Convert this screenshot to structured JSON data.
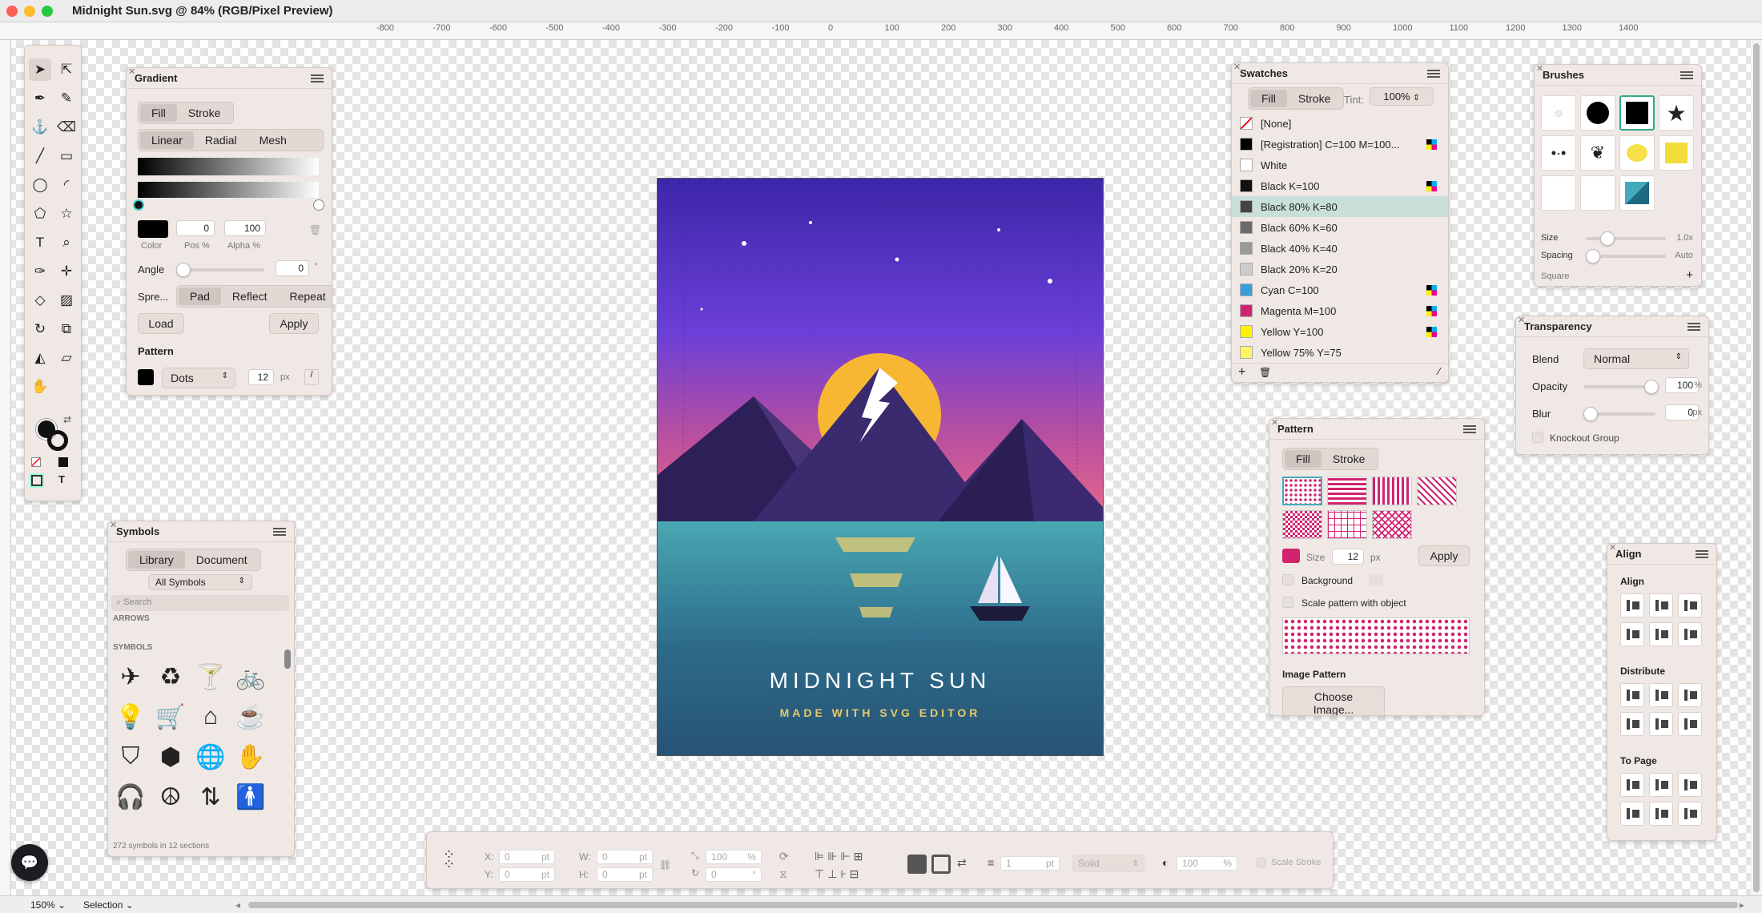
{
  "window": {
    "title": "Midnight Sun.svg @ 84% (RGB/Pixel Preview)"
  },
  "ruler": {
    "ticks": [
      "-800",
      "-700",
      "-600",
      "-500",
      "-400",
      "-300",
      "-200",
      "-100",
      "0",
      "100",
      "200",
      "300",
      "400",
      "500",
      "600",
      "700",
      "800",
      "900",
      "1000",
      "1100",
      "1200",
      "1300",
      "1400"
    ]
  },
  "status": {
    "zoom": "150%",
    "mode": "Selection"
  },
  "gradient": {
    "title": "Gradient",
    "fill": "Fill",
    "stroke": "Stroke",
    "linear": "Linear",
    "radial": "Radial",
    "mesh": "Mesh",
    "pos": "0",
    "alpha": "100",
    "color_label": "Color",
    "pos_label": "Pos %",
    "alpha_label": "Alpha %",
    "angle_label": "Angle",
    "angle": "0",
    "deg": "°",
    "spread_label": "Spre...",
    "pad": "Pad",
    "reflect": "Reflect",
    "repeat": "Repeat",
    "load": "Load",
    "apply": "Apply",
    "pattern_label": "Pattern",
    "pattern_value": "Dots",
    "pattern_size": "12",
    "unit": "px"
  },
  "swatches": {
    "title": "Swatches",
    "fill": "Fill",
    "stroke": "Stroke",
    "tint_label": "Tint:",
    "tint": "100%",
    "items": [
      {
        "name": "[None]",
        "color": "none"
      },
      {
        "name": "[Registration] C=100 M=100...",
        "color": "#000000"
      },
      {
        "name": "White",
        "color": "#ffffff"
      },
      {
        "name": "Black K=100",
        "color": "#111111"
      },
      {
        "name": "Black 80% K=80",
        "color": "#444444"
      },
      {
        "name": "Black 60% K=60",
        "color": "#6b6b6b"
      },
      {
        "name": "Black 40% K=40",
        "color": "#999999"
      },
      {
        "name": "Black 20% K=20",
        "color": "#cccccc"
      },
      {
        "name": "Cyan C=100",
        "color": "#3a9fd8"
      },
      {
        "name": "Magenta M=100",
        "color": "#d0246f"
      },
      {
        "name": "Yellow Y=100",
        "color": "#fff200"
      },
      {
        "name": "Yellow 75% Y=75",
        "color": "#fff566"
      }
    ]
  },
  "brushes": {
    "title": "Brushes",
    "size_label": "Size",
    "size_value": "1.0x",
    "spacing_label": "Spacing",
    "spacing_value": "Auto",
    "shape": "Square"
  },
  "transparency": {
    "title": "Transparency",
    "blend_label": "Blend",
    "blend": "Normal",
    "opacity_label": "Opacity",
    "opacity": "100",
    "pct": "%",
    "blur_label": "Blur",
    "blur": "0",
    "px": "px",
    "knockout": "Knockout Group"
  },
  "pattern": {
    "title": "Pattern",
    "fill": "Fill",
    "stroke": "Stroke",
    "size_label": "Size",
    "size": "12",
    "px": "px",
    "apply": "Apply",
    "background": "Background",
    "scale": "Scale pattern with object",
    "image_label": "Image Pattern",
    "choose": "Choose Image..."
  },
  "align": {
    "title": "Align",
    "align": "Align",
    "distribute": "Distribute",
    "to_page": "To Page"
  },
  "symbols": {
    "title": "Symbols",
    "library": "Library",
    "document": "Document",
    "dropdown": "All Symbols",
    "search_placeholder": "Search",
    "section_arrows": "ARROWS",
    "section_symbols": "SYMBOLS",
    "footer": "272 symbols in 12 sections",
    "items": [
      "✈",
      "♻",
      "🍸",
      "🚲",
      "💡",
      "🛒",
      "⌂",
      "☕",
      "⛉",
      "⬢",
      "🌐",
      "✋",
      "🎧",
      "☮",
      "⇅",
      "🚹"
    ]
  },
  "bottombar": {
    "x": "X:",
    "y": "Y:",
    "w": "W:",
    "h": "H:",
    "x_val": "0",
    "y_val": "0",
    "w_val": "0",
    "h_val": "0",
    "unit": "pt",
    "scale": "100",
    "pct": "%",
    "rot": "0",
    "stroke_w": "1",
    "stroke_style": "Solid",
    "opacity": "100",
    "scale_stroke": "Scale Stroke"
  },
  "artwork": {
    "title": "MIDNIGHT SUN",
    "subtitle": "MADE WITH SVG EDITOR"
  },
  "colors": {
    "sky_top": "#4a2db8",
    "sky_bottom": "#e0608a",
    "sun": "#f7b733",
    "sea_top": "#48a8b4",
    "sea_bottom": "#1e3a60",
    "accent": "#c9dfd9"
  }
}
